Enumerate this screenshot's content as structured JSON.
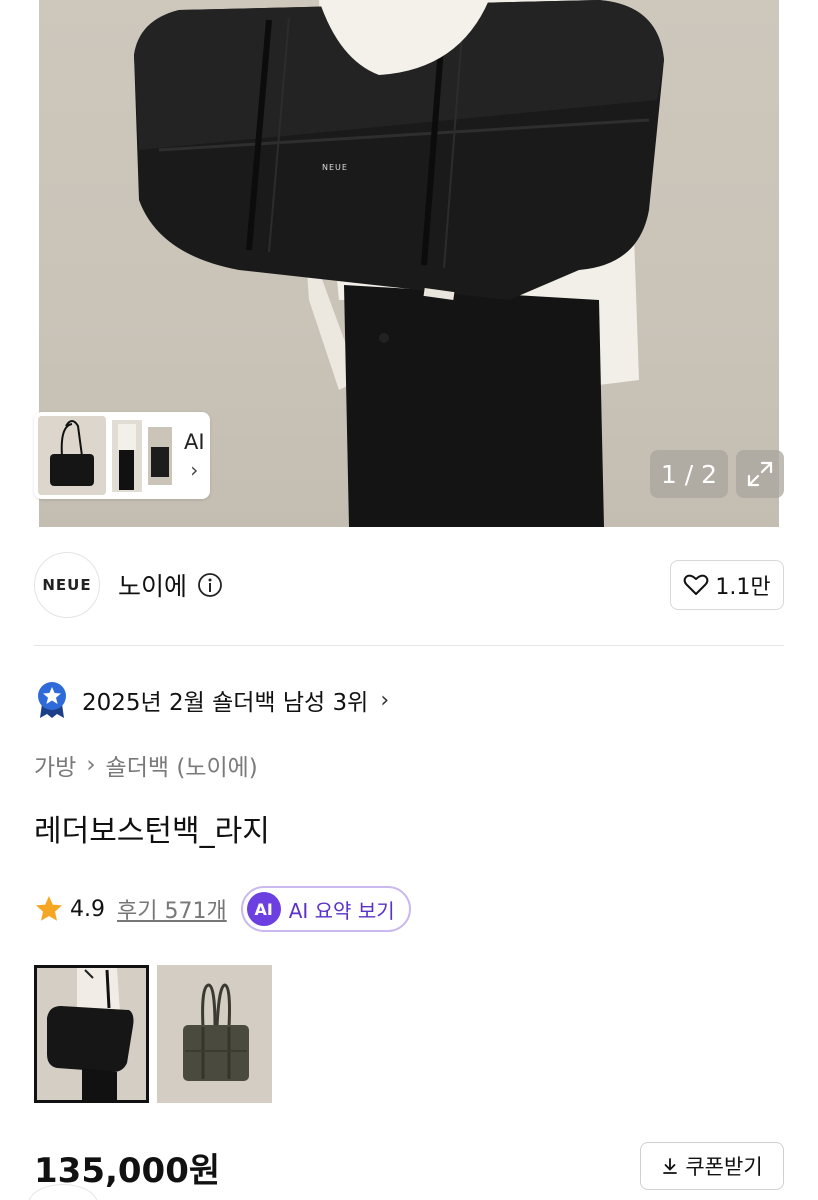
{
  "hero": {
    "ai_label": "AI",
    "ai_chevron": "›",
    "counter": "1 / 2",
    "bag_logo": "NEUE",
    "expand_icon": "expand-icon"
  },
  "brand": {
    "logo_text": "NEUE",
    "name": "노이에",
    "info_icon": "info-icon",
    "likes": "1.1만"
  },
  "ranking": {
    "text": "2025년 2월 숄더백 남성 3위",
    "chevron": "›",
    "icon": "medal-star-icon",
    "icon_color": "#2f6bd8"
  },
  "breadcrumb": {
    "category": "가방",
    "separator": "›",
    "subcategory": "숄더백 (노이에)"
  },
  "product": {
    "title": "레더보스턴백_라지",
    "rating": "4.9",
    "reviews": "후기 571개",
    "ai_badge": "AI",
    "ai_summary": "AI 요약 보기",
    "price": "135,000원",
    "coupon": "쿠폰받기",
    "coupon_icon": "download-icon"
  },
  "colors": {
    "star": "#f5a623",
    "ai_purple": "#6b3fe0",
    "rank_blue": "#2f6bd8"
  }
}
